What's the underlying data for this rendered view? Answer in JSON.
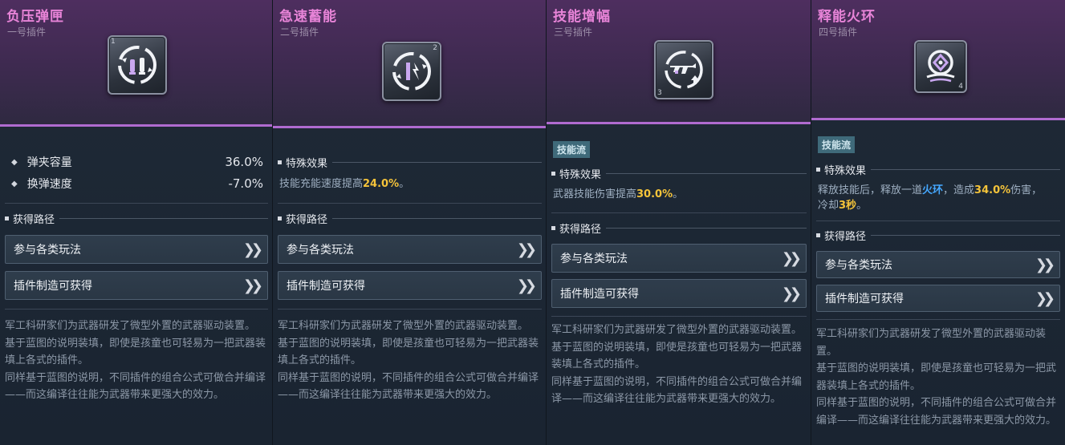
{
  "common": {
    "route_label": "获得路径",
    "effect_label": "特殊效果",
    "route_buttons": [
      "参与各类玩法",
      "插件制造可获得"
    ],
    "description_lines": [
      "军工科研家们为武器研发了微型外置的武器驱动装置。",
      "基于蓝图的说明装填，即使是孩童也可轻易为一把武器装填上各式的插件。",
      "同样基于蓝图的说明，不同插件的组合公式可做合并编译——而这编译往往能为武器带来更强大的效力。"
    ]
  },
  "cards": [
    {
      "title": "负压弹匣",
      "subtitle": "一号插件",
      "slot": "1",
      "icon": "ammo-cycle-icon",
      "stats": [
        {
          "label": "弹夹容量",
          "value": "36.0%"
        },
        {
          "label": "换弹速度",
          "value": "-7.0%"
        }
      ]
    },
    {
      "title": "急速蓄能",
      "subtitle": "二号插件",
      "slot": "2",
      "icon": "charge-cycle-icon",
      "effect": {
        "pre": "技能充能速度提高",
        "value": "24.0%",
        "post": "。"
      }
    },
    {
      "title": "技能增幅",
      "subtitle": "三号插件",
      "slot": "3",
      "icon": "gun-boost-icon",
      "tag": "技能流",
      "effect": {
        "pre": "武器技能伤害提高",
        "value": "30.0%",
        "post": "。"
      }
    },
    {
      "title": "释能火环",
      "subtitle": "四号插件",
      "slot": "4",
      "icon": "fire-ring-icon",
      "tag": "技能流",
      "effect": {
        "pre": "释放技能后，释放一道",
        "keyword": "火环",
        "mid": "，造成",
        "value": "34.0%",
        "post": "伤害，",
        "line2_pre": "冷却",
        "cooldown": "3秒",
        "line2_post": "。"
      }
    }
  ],
  "colors": {
    "title": "#e884d8",
    "accent_line": "#b06bd0",
    "highlight": "#f5c43a",
    "keyword": "#45a8ff",
    "tag_bg": "#3f6a7a"
  }
}
